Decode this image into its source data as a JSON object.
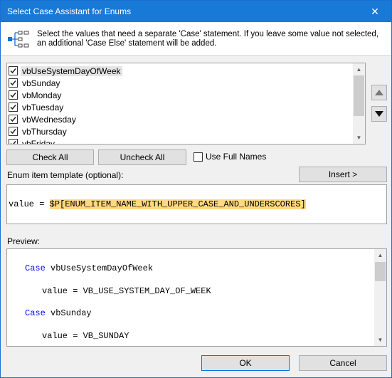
{
  "window": {
    "title": "Select Case Assistant for Enums",
    "close_glyph": "✕"
  },
  "header": {
    "icon": "list-tree-icon",
    "description": "Select the values that need a separate 'Case' statement. If you leave some value not selected, an additional 'Case Else' statement will be added."
  },
  "enum_list": {
    "items": [
      {
        "label": "vbUseSystemDayOfWeek",
        "checked": true
      },
      {
        "label": "vbSunday",
        "checked": true
      },
      {
        "label": "vbMonday",
        "checked": true
      },
      {
        "label": "vbTuesday",
        "checked": true
      },
      {
        "label": "vbWednesday",
        "checked": true
      },
      {
        "label": "vbThursday",
        "checked": true
      },
      {
        "label": "vbFriday",
        "checked": true
      }
    ],
    "move_up_icon": "triangle-up-icon",
    "move_down_icon": "triangle-down-icon"
  },
  "buttons": {
    "check_all": "Check All",
    "uncheck_all": "Uncheck All",
    "insert": "Insert >",
    "ok": "OK",
    "cancel": "Cancel"
  },
  "options": {
    "use_full_names_label": "Use Full Names",
    "use_full_names_checked": false
  },
  "template": {
    "label": "Enum item template (optional):",
    "prefix": "value = ",
    "token": "$P[ENUM_ITEM_NAME_WITH_UPPER_CASE_AND_UNDERSCORES]"
  },
  "preview": {
    "label": "Preview:",
    "lines": [
      {
        "keyword": "Case",
        "text": " vbUseSystemDayOfWeek"
      },
      {
        "keyword": "",
        "text": "value = VB_USE_SYSTEM_DAY_OF_WEEK"
      },
      {
        "keyword": "Case",
        "text": " vbSunday"
      },
      {
        "keyword": "",
        "text": "value = VB_SUNDAY"
      }
    ]
  },
  "colors": {
    "title_bar": "#1979d6",
    "keyword": "#0000ff",
    "token_highlight": "#ffd980"
  }
}
